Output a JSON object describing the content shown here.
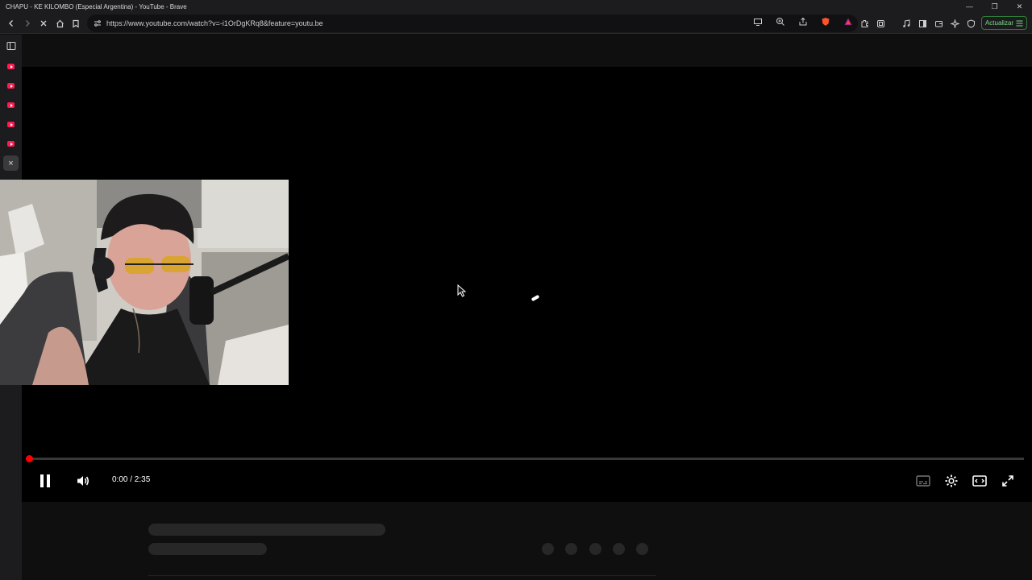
{
  "window": {
    "title": "CHAPU - KE KILOMBO (Especial Argentina) - YouTube - Brave",
    "minimize_icon": "minimize-icon",
    "restore_icon": "restore-icon",
    "close_icon": "close-icon"
  },
  "toolbar": {
    "url": "https://www.youtube.com/watch?v=-i1OrDgKRq8&feature=youtu.be",
    "update_label": "Actualizar"
  },
  "sidebar": {
    "items": [
      {
        "icon": "youtube-icon"
      },
      {
        "icon": "youtube-icon"
      },
      {
        "icon": "youtube-icon"
      },
      {
        "icon": "youtube-icon"
      },
      {
        "icon": "youtube-icon"
      }
    ],
    "close_label": "×"
  },
  "player": {
    "time": "0:00 / 2:35",
    "progress": 0,
    "state": "playing"
  },
  "colors": {
    "accent": "#ff0000",
    "update_border": "#2f7d3b",
    "sidebar_icon": "#ff1a4f"
  }
}
